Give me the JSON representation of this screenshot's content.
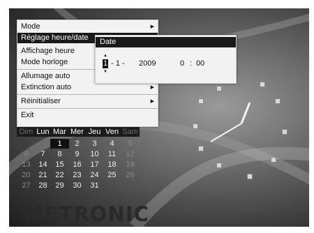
{
  "menu": {
    "items": [
      {
        "label": "Mode",
        "submenu": true
      },
      {
        "label": "Réglage heure/date",
        "selected": true
      },
      {
        "label": "Affichage heure"
      },
      {
        "label": "Mode horloge"
      },
      {
        "label": "Allumage auto"
      },
      {
        "label": "Extinction auto",
        "submenu": true
      },
      {
        "label": "Réinitialiser",
        "submenu": true
      },
      {
        "label": "Exit"
      }
    ]
  },
  "date_panel": {
    "title": "Date",
    "day": "1",
    "sep1": "- 1 -",
    "year": "2009",
    "hour": "0",
    "colon": ":",
    "minute": "00"
  },
  "calendar": {
    "weekdays": [
      "Dim",
      "Lun",
      "Mar",
      "Mer",
      "Jeu",
      "Ven",
      "Sam"
    ],
    "rows": [
      [
        "",
        "",
        "1",
        "2",
        "3",
        "4",
        "5"
      ],
      [
        "6",
        "7",
        "8",
        "9",
        "10",
        "11",
        "12"
      ],
      [
        "13",
        "14",
        "15",
        "16",
        "17",
        "18",
        "19"
      ],
      [
        "20",
        "21",
        "22",
        "23",
        "24",
        "25",
        "26"
      ],
      [
        "27",
        "28",
        "29",
        "30",
        "31",
        "",
        ""
      ]
    ],
    "today": "1"
  },
  "brand": "METRONIC",
  "colors": {
    "menu_bg": "#f2f2f2",
    "highlight": "#1a1a1a"
  }
}
